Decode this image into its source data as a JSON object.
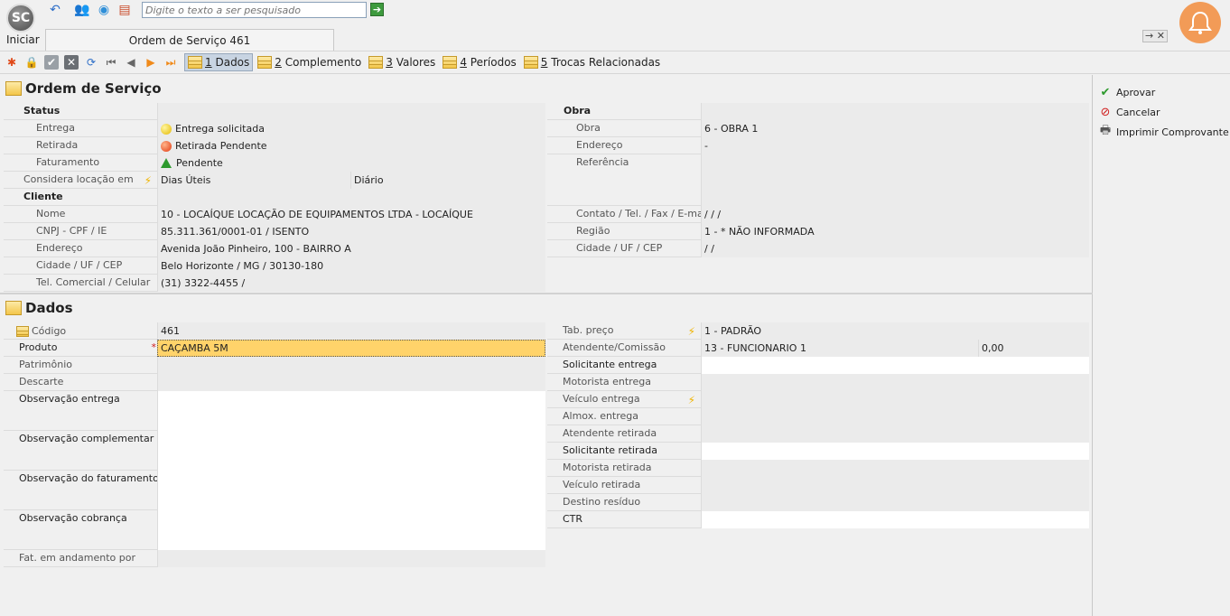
{
  "app": {
    "logo_text": "SC",
    "start_label": "Iniciar"
  },
  "search": {
    "placeholder": "Digite o texto a ser pesquisado"
  },
  "tab": {
    "title": "Ordem de Serviço 461",
    "controls": "→ ✕"
  },
  "toolbar": {
    "tabs": [
      {
        "num": "1",
        "label": "Dados"
      },
      {
        "num": "2",
        "label": "Complemento"
      },
      {
        "num": "3",
        "label": "Valores"
      },
      {
        "num": "4",
        "label": "Períodos"
      },
      {
        "num": "5",
        "label": "Trocas Relacionadas"
      }
    ]
  },
  "os": {
    "title": "Ordem de Serviço",
    "status_header": "Status",
    "entrega_label": "Entrega",
    "entrega_value": "Entrega solicitada",
    "retirada_label": "Retirada",
    "retirada_value": "Retirada Pendente",
    "faturamento_label": "Faturamento",
    "faturamento_value": "Pendente",
    "considera_label": "Considera locação em",
    "considera_value1": "Dias Úteis",
    "considera_value2": "Diário",
    "cliente_header": "Cliente",
    "nome_label": "Nome",
    "nome_value": "10 - LOCAÍQUE LOCAÇÃO DE EQUIPAMENTOS LTDA - LOCAÍQUE",
    "cnpj_label": "CNPJ - CPF / IE",
    "cnpj_value": "85.311.361/0001-01 / ISENTO",
    "endereco_label": "Endereço",
    "endereco_value": "Avenida João Pinheiro, 100 - BAIRRO A",
    "cidade_label": "Cidade / UF / CEP",
    "cidade_value": "Belo Horizonte / MG / 30130-180",
    "tel_label": "Tel. Comercial / Celular",
    "tel_value": "(31) 3322-4455 /",
    "obra_header": "Obra",
    "obra_label": "Obra",
    "obra_value": "6 - OBRA 1",
    "obra_endereco_label": "Endereço",
    "obra_endereco_value": "-",
    "referencia_label": "Referência",
    "referencia_value": "",
    "contato_label": "Contato / Tel. / Fax / E-mail",
    "contato_value": "/ / /",
    "regiao_label": "Região",
    "regiao_value": "1 - * NÃO INFORMADA",
    "obra_cidade_label": "Cidade / UF / CEP",
    "obra_cidade_value": "/ /"
  },
  "dados": {
    "title": "Dados",
    "codigo_label": "Código",
    "codigo_value": "461",
    "produto_label": "Produto",
    "produto_value": "CAÇAMBA 5M",
    "required_mark": "*",
    "patrimonio_label": "Patrimônio",
    "descarte_label": "Descarte",
    "obs_entrega_label": "Observação entrega",
    "obs_complementar_label": "Observação complementar",
    "obs_faturamento_label": "Observação do faturamento",
    "obs_cobranca_label": "Observação cobrança",
    "fat_andamento_label": "Fat. em andamento por",
    "tab_preco_label": "Tab. preço",
    "tab_preco_value": "1 - PADRÃO",
    "atendente_label": "Atendente/Comissão",
    "atendente_value": "13 - FUNCIONARIO 1",
    "comissao_value": "0,00",
    "solicitante_entrega_label": "Solicitante entrega",
    "motorista_entrega_label": "Motorista entrega",
    "veiculo_entrega_label": "Veículo entrega",
    "almox_entrega_label": "Almox. entrega",
    "atendente_retirada_label": "Atendente retirada",
    "solicitante_retirada_label": "Solicitante retirada",
    "motorista_retirada_label": "Motorista retirada",
    "veiculo_retirada_label": "Veículo retirada",
    "destino_residuo_label": "Destino resíduo",
    "ctr_label": "CTR"
  },
  "side": {
    "aprovar": "Aprovar",
    "cancelar": "Cancelar",
    "imprimir": "Imprimir Comprovante de"
  },
  "colors": {
    "accent": "#f29b57",
    "highlight": "#ffd36a"
  }
}
